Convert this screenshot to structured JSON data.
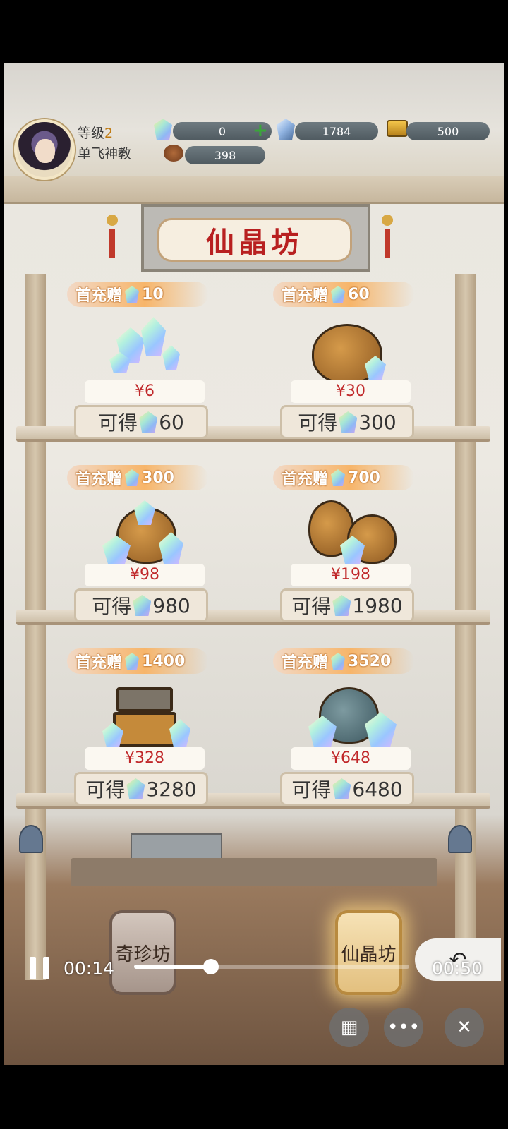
{
  "player": {
    "level_label": "等级",
    "level": "2",
    "guild": "单飞神教"
  },
  "resources": {
    "crystal": "0",
    "diamond": "1784",
    "gold": "500",
    "stamina": "398"
  },
  "shop": {
    "title": "仙晶坊",
    "bonus_label": "首充赠",
    "gain_label": "可得",
    "packs": [
      {
        "bonus": "10",
        "price": "¥6",
        "gain": "60"
      },
      {
        "bonus": "60",
        "price": "¥30",
        "gain": "300"
      },
      {
        "bonus": "300",
        "price": "¥98",
        "gain": "980"
      },
      {
        "bonus": "700",
        "price": "¥198",
        "gain": "1980"
      },
      {
        "bonus": "1400",
        "price": "¥328",
        "gain": "3280"
      },
      {
        "bonus": "3520",
        "price": "¥648",
        "gain": "6480"
      }
    ]
  },
  "tabs": {
    "treasure": "奇珍坊",
    "crystal": "仙晶坊"
  },
  "video": {
    "current_time": "00:14",
    "duration": "00:50",
    "progress": 0.28
  },
  "icons": {
    "crystal": "crystal-icon",
    "diamond": "diamond-icon",
    "gold": "gold-icon",
    "stamina": "stamina-icon",
    "add": "plus-icon",
    "pause": "pause-icon",
    "grid": "grid-icon",
    "more": "more-icon",
    "close": "close-icon",
    "return": "return-icon"
  },
  "colors": {
    "price_red": "#c0282a",
    "title_red": "#b82020",
    "bonus_orange": "#f7b56a",
    "add_green": "#3aa63a"
  }
}
